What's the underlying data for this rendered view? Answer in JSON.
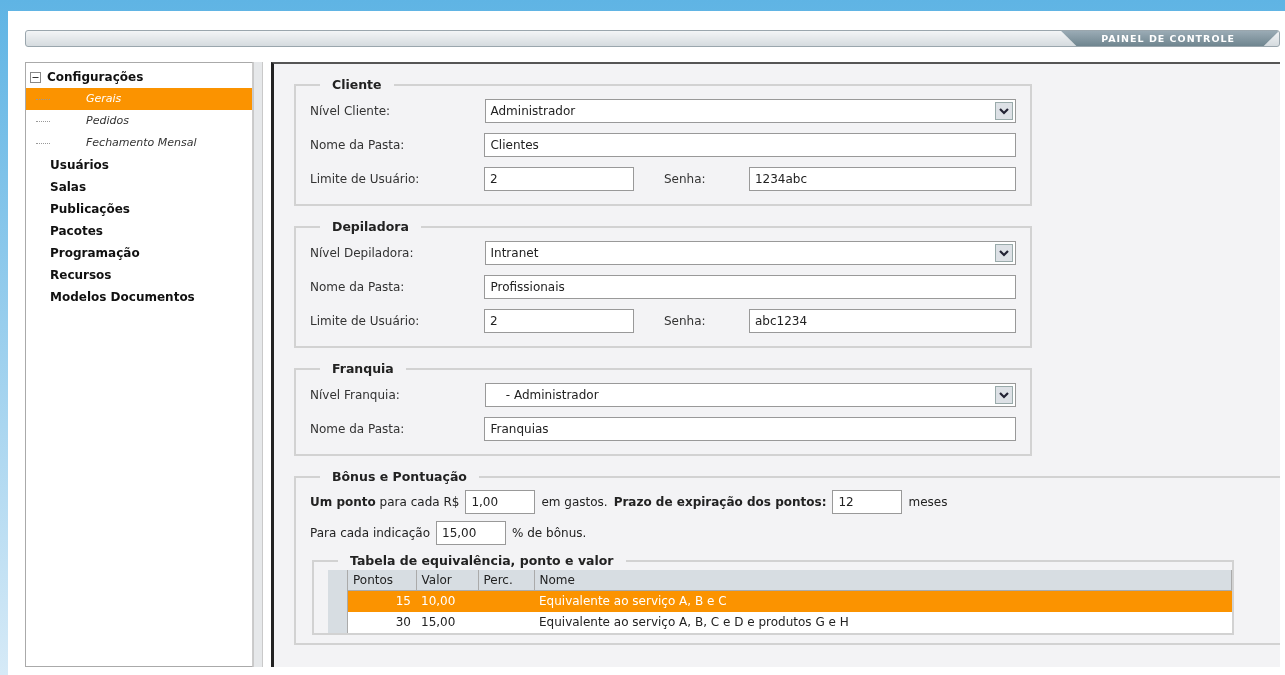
{
  "header": {
    "title": "PAINEL DE CONTROLE"
  },
  "sidebar": {
    "items": [
      {
        "label": "Configurações",
        "expanded": true,
        "children": [
          {
            "label": "Gerais",
            "selected": true
          },
          {
            "label": "Pedidos",
            "selected": false
          },
          {
            "label": "Fechamento Mensal",
            "selected": false
          }
        ]
      },
      {
        "label": "Usuários"
      },
      {
        "label": "Salas"
      },
      {
        "label": "Publicações"
      },
      {
        "label": "Pacotes"
      },
      {
        "label": "Programação"
      },
      {
        "label": "Recursos"
      },
      {
        "label": "Modelos Documentos"
      }
    ]
  },
  "sections": [
    {
      "title": "Cliente",
      "rows": [
        [
          {
            "kind": "select",
            "label": "Nível Cliente:",
            "value": "Administrador"
          }
        ],
        [
          {
            "kind": "text",
            "label": "Nome da Pasta:",
            "value": "Clientes"
          }
        ],
        [
          {
            "kind": "short",
            "label": "Limite de Usuário:",
            "value": "2"
          },
          {
            "kind": "short",
            "label": "Senha:",
            "value": "1234abc"
          }
        ]
      ]
    },
    {
      "title": "Depiladora",
      "rows": [
        [
          {
            "kind": "select",
            "label": "Nível Depiladora:",
            "value": "Intranet"
          }
        ],
        [
          {
            "kind": "text",
            "label": "Nome da Pasta:",
            "value": "Profissionais"
          }
        ],
        [
          {
            "kind": "short",
            "label": "Limite de Usuário:",
            "value": "2"
          },
          {
            "kind": "short",
            "label": "Senha:",
            "value": "abc1234"
          }
        ]
      ]
    },
    {
      "title": "Franquia",
      "rows": [
        [
          {
            "kind": "select",
            "label": "Nível Franquia:",
            "value": "    - Administrador"
          }
        ],
        [
          {
            "kind": "text",
            "label": "Nome da Pasta:",
            "value": "Franquias"
          }
        ]
      ]
    }
  ],
  "bonus": {
    "title": "Bônus e Pontuação",
    "lines": [
      [
        {
          "kind": "text",
          "text": "**Um ponto** para cada R$"
        },
        {
          "kind": "input",
          "value": "1,00"
        },
        {
          "kind": "text",
          "text": "em gastos."
        },
        {
          "kind": "text",
          "text": "**Prazo de expiração dos pontos:**"
        },
        {
          "kind": "input",
          "value": "12"
        },
        {
          "kind": "text",
          "text": "meses"
        }
      ],
      [
        {
          "kind": "text",
          "text": "Para cada indicação"
        },
        {
          "kind": "input",
          "value": "15,00"
        },
        {
          "kind": "text",
          "text": "% de bônus."
        }
      ]
    ],
    "table": {
      "title": "Tabela de equivalência, ponto e valor",
      "columns": [
        "Pontos",
        "Valor",
        "Perc.",
        "Nome"
      ],
      "rows": [
        {
          "pontos": "15",
          "valor": "10,00",
          "nome": "Equivalente ao serviço A, B e C",
          "selected": true
        },
        {
          "pontos": "30",
          "valor": "15,00",
          "nome": "Equivalente ao serviço A, B, C e D e produtos G e H",
          "selected": false
        }
      ]
    }
  }
}
